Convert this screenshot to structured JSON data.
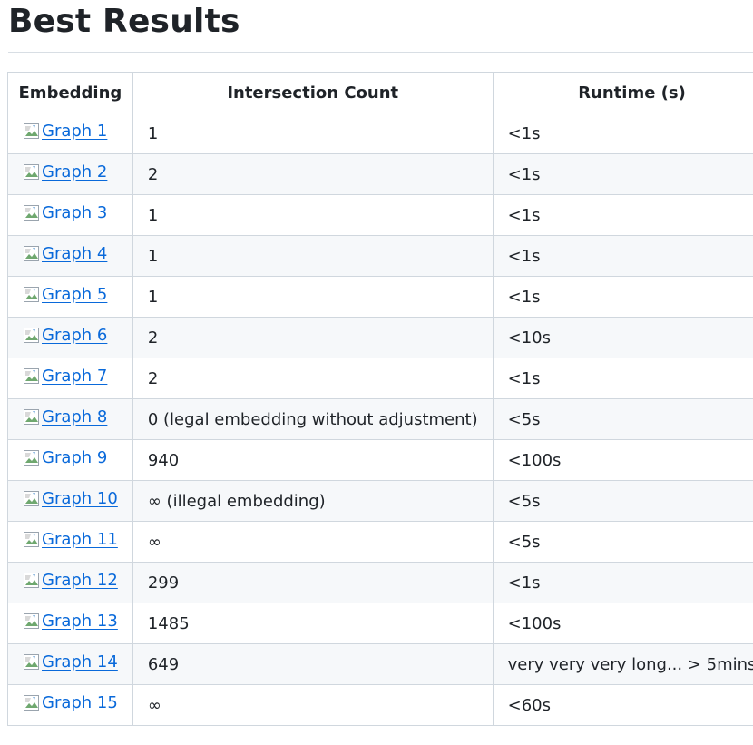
{
  "heading": "Best Results",
  "table": {
    "headers": {
      "embedding": "Embedding",
      "count": "Intersection Count",
      "runtime": "Runtime (s)"
    },
    "rows": [
      {
        "graph": "Graph 1",
        "count": "1",
        "runtime": "<1s"
      },
      {
        "graph": "Graph 2",
        "count": "2",
        "runtime": "<1s"
      },
      {
        "graph": "Graph 3",
        "count": "1",
        "runtime": "<1s"
      },
      {
        "graph": "Graph 4",
        "count": "1",
        "runtime": "<1s"
      },
      {
        "graph": "Graph 5",
        "count": "1",
        "runtime": "<1s"
      },
      {
        "graph": "Graph 6",
        "count": "2",
        "runtime": "<10s"
      },
      {
        "graph": "Graph 7",
        "count": "2",
        "runtime": "<1s"
      },
      {
        "graph": "Graph 8",
        "count": "0 (legal embedding without adjustment)",
        "runtime": "<5s"
      },
      {
        "graph": "Graph 9",
        "count": "940",
        "runtime": "<100s"
      },
      {
        "graph": "Graph 10",
        "count": "∞ (illegal embedding)",
        "runtime": "<5s"
      },
      {
        "graph": "Graph 11",
        "count": "∞",
        "runtime": "<5s"
      },
      {
        "graph": "Graph 12",
        "count": "299",
        "runtime": "<1s"
      },
      {
        "graph": "Graph 13",
        "count": "1485",
        "runtime": "<100s"
      },
      {
        "graph": "Graph 14",
        "count": "649",
        "runtime": "very very very long... > 5mins"
      },
      {
        "graph": "Graph 15",
        "count": "∞",
        "runtime": "<60s"
      }
    ]
  },
  "colors": {
    "link": "#0969da",
    "border": "#d0d7de",
    "stripe": "#f6f8fa",
    "text": "#1f2328"
  },
  "icons": {
    "graph_image": "broken-image-icon"
  }
}
